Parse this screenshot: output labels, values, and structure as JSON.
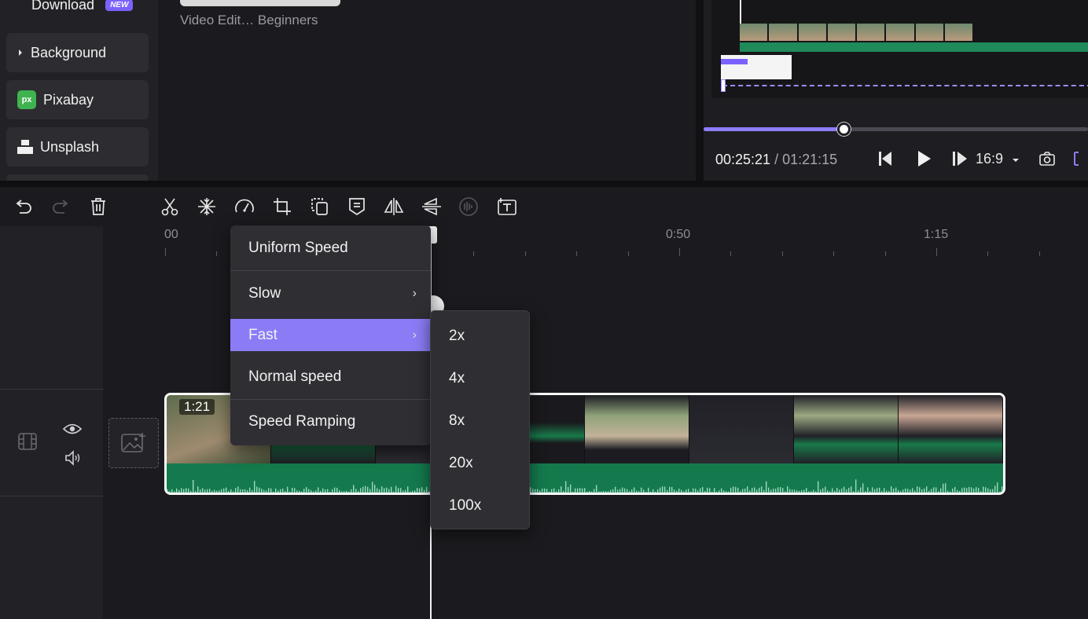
{
  "sidebar": {
    "download_label": "Download",
    "new_badge": "NEW",
    "background_label": "Background",
    "pixabay_icon_text": "px",
    "pixabay_label": "Pixabay",
    "unsplash_label": "Unsplash"
  },
  "media": {
    "caption": "Video Edit… Beginners"
  },
  "preview": {
    "current_time": "00:25:21",
    "separator": " / ",
    "total_time": "01:21:15",
    "aspect_ratio": "16:9",
    "progress": 0.365
  },
  "toolbar": {
    "icons": [
      "undo-icon",
      "redo-icon",
      "delete-icon",
      "split-icon",
      "freeze-icon",
      "speed-icon",
      "crop-icon",
      "duplicate-icon",
      "caption-icon",
      "flip-horizontal-icon",
      "flip-vertical-icon",
      "denoise-icon",
      "text-icon"
    ]
  },
  "timeline": {
    "ruler_labels": [
      "00",
      "0:50",
      "1:15"
    ],
    "clip_duration": "1:21"
  },
  "speed_menu": {
    "items": [
      {
        "label": "Uniform Speed",
        "submenu": false,
        "active": false
      },
      {
        "label": "Slow",
        "submenu": true,
        "active": false
      },
      {
        "label": "Fast",
        "submenu": true,
        "active": true
      },
      {
        "label": "Normal speed",
        "submenu": false,
        "active": false
      },
      {
        "label": "Speed Ramping",
        "submenu": false,
        "active": false
      }
    ],
    "chevron": "›"
  },
  "fast_submenu": {
    "items": [
      "2x",
      "4x",
      "8x",
      "20x",
      "100x"
    ]
  },
  "colors": {
    "accent": "#8b7cf6",
    "audio_green": "#147a4d",
    "background": "#1b1b1f"
  }
}
